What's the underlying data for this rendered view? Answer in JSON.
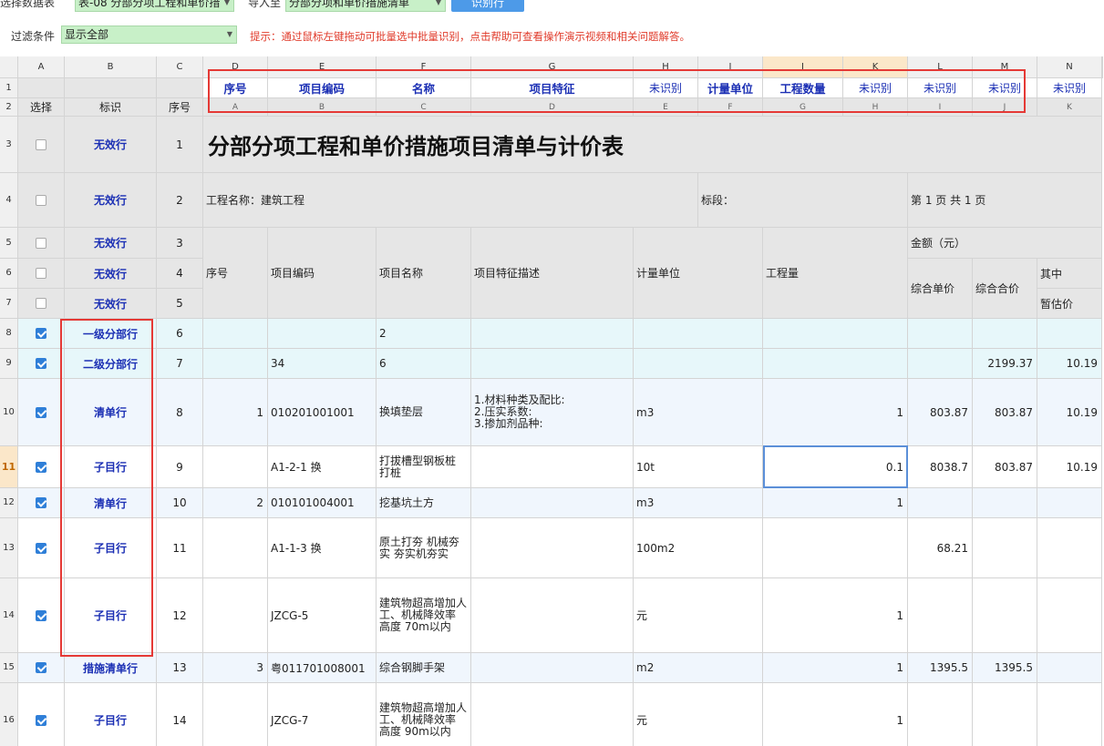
{
  "toolbar": {
    "select_table_label": "选择数据表",
    "table_value": "表-08 分部分项工程和单价措",
    "import_label": "导入至",
    "import_value": "分部分项和单价措施清单",
    "recognize_button": "识别行",
    "filter_label": "过滤条件",
    "filter_value": "显示全部",
    "hint": "提示：通过鼠标左键拖动可批量选中批量识别，点击帮助可查看操作演示视频和相关问题解答。"
  },
  "columns": {
    "letters": [
      "A",
      "B",
      "C",
      "D",
      "E",
      "F",
      "G",
      "H",
      "I",
      "J",
      "K",
      "L",
      "M",
      "N"
    ],
    "mapping": [
      "",
      "",
      "",
      "序号",
      "项目编码",
      "名称",
      "项目特征",
      "未识别",
      "计量单位",
      "工程数量",
      "未识别",
      "未识别",
      "未识别",
      "未识别"
    ],
    "source_letters": [
      "选择",
      "标识",
      "序号",
      "A",
      "B",
      "C",
      "D",
      "E",
      "F",
      "G",
      "H",
      "I",
      "J",
      "K"
    ]
  },
  "row_numbers": [
    "1",
    "2",
    "3",
    "4",
    "5",
    "6",
    "7",
    "8",
    "9",
    "10",
    "11",
    "12",
    "13",
    "14",
    "15",
    "16"
  ],
  "rows": [
    {
      "tag": "无效行",
      "seq": "1",
      "checked": false
    },
    {
      "tag": "无效行",
      "seq": "2",
      "checked": false
    },
    {
      "tag": "无效行",
      "seq": "3",
      "checked": false
    },
    {
      "tag": "无效行",
      "seq": "4",
      "checked": false
    },
    {
      "tag": "无效行",
      "seq": "5",
      "checked": false
    },
    {
      "tag": "一级分部行",
      "seq": "6",
      "checked": true,
      "d": "",
      "e": "",
      "f": "2",
      "g": "",
      "h": "",
      "i": "",
      "j": "",
      "l": "",
      "m": "",
      "n": ""
    },
    {
      "tag": "二级分部行",
      "seq": "7",
      "checked": true,
      "d": "",
      "e": "34",
      "f": "6",
      "g": "",
      "h": "",
      "i": "",
      "j": "",
      "l": "",
      "m": "2199.37",
      "n": "10.19"
    },
    {
      "tag": "清单行",
      "seq": "8",
      "checked": true,
      "d": "1",
      "e": "010201001001",
      "f": "换填垫层",
      "g": "1.材料种类及配比:\n2.压实系数:\n3.掺加剂品种:",
      "h": "",
      "i": "m3",
      "j": "1",
      "l": "803.87",
      "m": "803.87",
      "n": "10.19"
    },
    {
      "tag": "子目行",
      "seq": "9",
      "checked": true,
      "d": "",
      "e": "A1-2-1 换",
      "f": "打拔槽型钢板桩\n打桩",
      "g": "",
      "h": "",
      "i": "10t",
      "j": "0.1",
      "l": "8038.7",
      "m": "803.87",
      "n": "10.19"
    },
    {
      "tag": "清单行",
      "seq": "10",
      "checked": true,
      "d": "2",
      "e": "010101004001",
      "f": "挖基坑土方",
      "g": "",
      "h": "",
      "i": "m3",
      "j": "1",
      "l": "",
      "m": "",
      "n": ""
    },
    {
      "tag": "子目行",
      "seq": "11",
      "checked": true,
      "d": "",
      "e": "A1-1-3 换",
      "f": "原土打夯 机械夯\n实 夯实机夯实",
      "g": "",
      "h": "",
      "i": "100m2",
      "j": "",
      "l": "68.21",
      "m": "",
      "n": ""
    },
    {
      "tag": "子目行",
      "seq": "12",
      "checked": true,
      "d": "",
      "e": "JZCG-5",
      "f": "建筑物超高增加人\n工、机械降效率\n高度 70m以内",
      "g": "",
      "h": "",
      "i": "元",
      "j": "1",
      "l": "",
      "m": "",
      "n": ""
    },
    {
      "tag": "措施清单行",
      "seq": "13",
      "checked": true,
      "d": "3",
      "e": "粤011701008001",
      "f": "综合钢脚手架",
      "g": "",
      "h": "",
      "i": "m2",
      "j": "1",
      "l": "1395.5",
      "m": "1395.5",
      "n": ""
    },
    {
      "tag": "子目行",
      "seq": "14",
      "checked": true,
      "d": "",
      "e": "JZCG-7",
      "f": "建筑物超高增加人\n工、机械降效率\n高度 90m以内",
      "g": "",
      "h": "",
      "i": "元",
      "j": "1",
      "l": "",
      "m": "",
      "n": ""
    }
  ],
  "sheet": {
    "title": "分部分项工程和单价措施项目清单与计价表",
    "project_name": "工程名称：建筑工程",
    "section": "标段：",
    "page_info": "第 1 页  共 1 页",
    "h_seq": "序号",
    "h_code": "项目编码",
    "h_name": "项目名称",
    "h_feature": "项目特征描述",
    "h_unit": "计量单位",
    "h_qty": "工程量",
    "h_amount": "金额（元）",
    "h_unit_price": "综合单价",
    "h_total_price": "综合合价",
    "h_of_which": "其中",
    "h_provisional": "暂估价"
  }
}
